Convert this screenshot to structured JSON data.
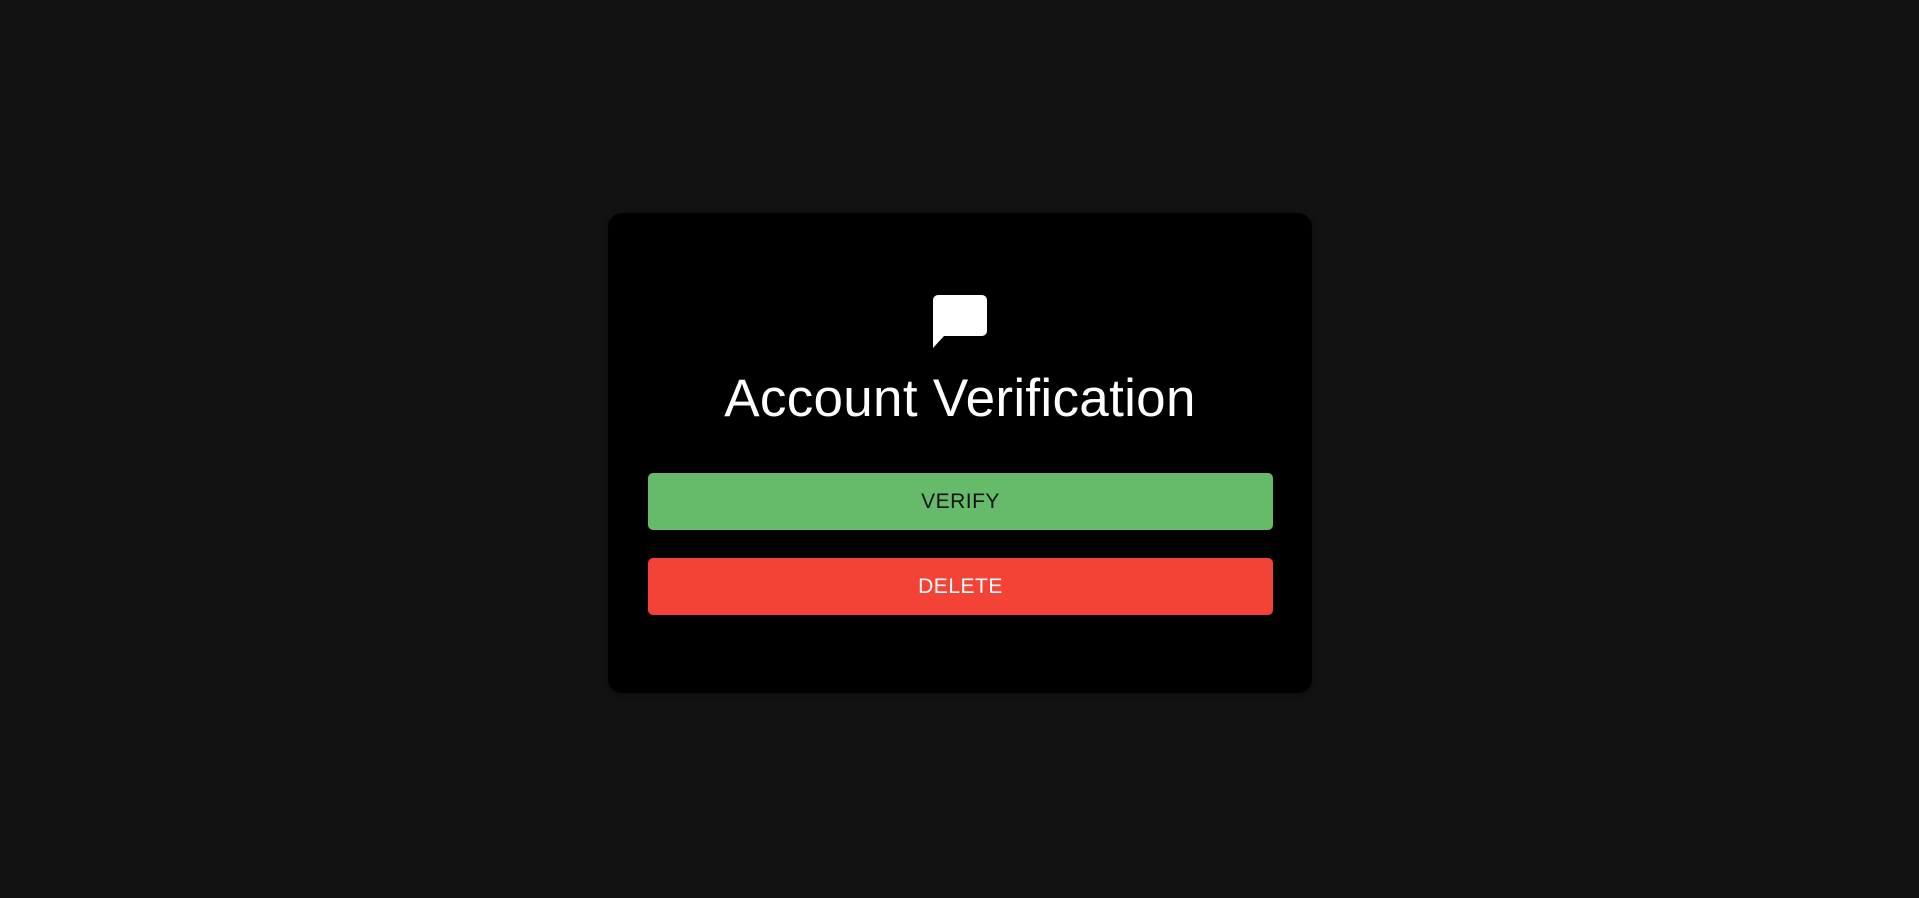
{
  "dialog": {
    "icon": "chat-bubble-icon",
    "title": "Account Verification",
    "verify_label": "VERIFY",
    "delete_label": "DELETE"
  },
  "colors": {
    "page_background": "#121212",
    "card_background": "#000000",
    "verify_button": "#66bb6a",
    "delete_button": "#f44336",
    "title_text": "#ffffff"
  }
}
